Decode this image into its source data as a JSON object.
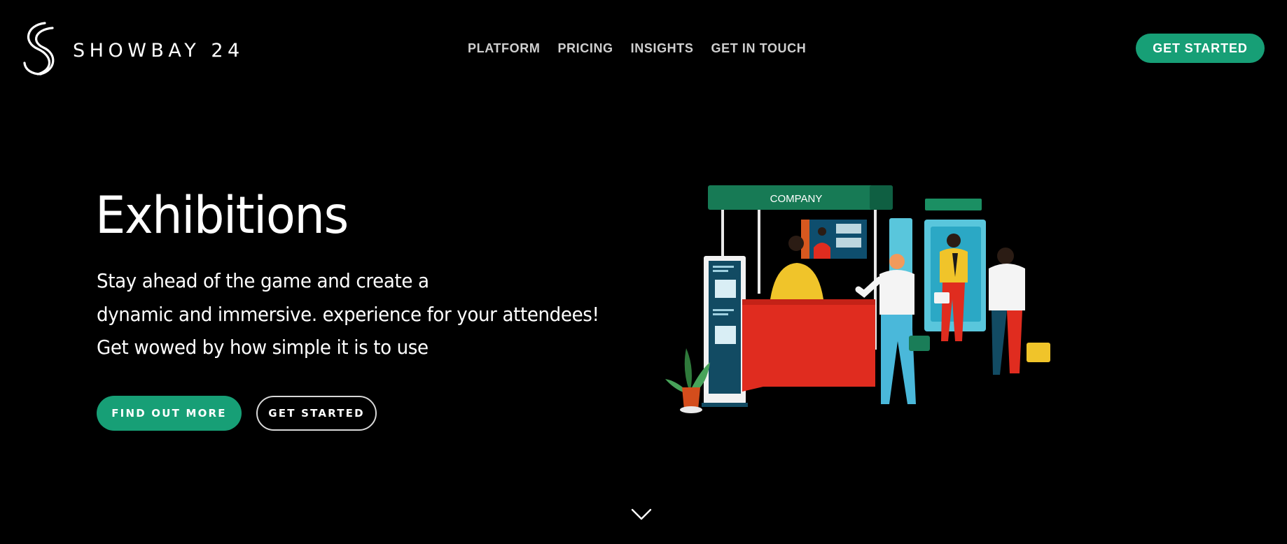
{
  "brand": {
    "name": "SHOWBAY 24"
  },
  "nav": {
    "items": [
      {
        "label": "PLATFORM"
      },
      {
        "label": "PRICING"
      },
      {
        "label": "INSIGHTS"
      },
      {
        "label": "GET IN TOUCH"
      }
    ]
  },
  "header": {
    "cta_label": "GET STARTED"
  },
  "hero": {
    "title": "Exhibitions",
    "subtitle_lines": [
      "Stay ahead of the game and create a",
      "dynamic and immersive. experience for your attendees!",
      "Get wowed by how simple it is to use"
    ],
    "primary_button": "FIND OUT MORE",
    "secondary_button": "GET STARTED"
  },
  "illustration": {
    "booth_sign": "COMPANY"
  },
  "icons": {
    "logo": "s-logo-icon",
    "scroll": "chevron-down-icon"
  },
  "colors": {
    "accent": "#179f76",
    "background": "#000000",
    "text": "#ffffff",
    "nav_text": "#cfcfcf"
  }
}
